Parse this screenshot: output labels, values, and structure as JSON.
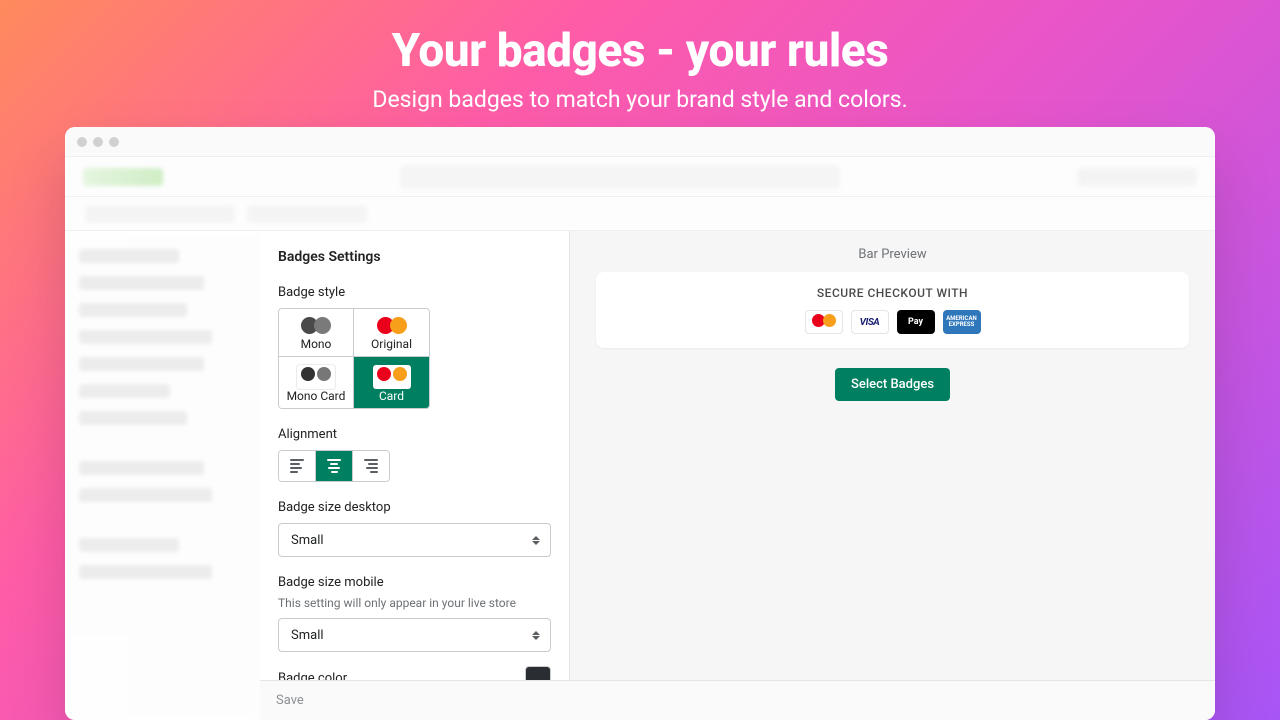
{
  "hero": {
    "title": "Your badges - your rules",
    "subtitle": "Design badges to match your brand style and colors."
  },
  "settings": {
    "heading": "Badges Settings",
    "style_label": "Badge style",
    "styles": {
      "mono": "Mono",
      "original": "Original",
      "mono_card": "Mono Card",
      "card": "Card"
    },
    "alignment_label": "Alignment",
    "size_desktop_label": "Badge size desktop",
    "size_desktop_value": "Small",
    "size_mobile_label": "Badge size mobile",
    "size_mobile_help": "This setting will only appear in your live store",
    "size_mobile_value": "Small",
    "badge_color_label": "Badge color",
    "badge_color_value": "#2a2e33"
  },
  "preview": {
    "label": "Bar Preview",
    "secure_text": "SECURE CHECKOUT WITH",
    "select_badges_btn": "Select Badges",
    "visa": "VISA",
    "apple_pay": "Pay",
    "amex": "AMERICAN EXPRESS"
  },
  "footer": {
    "save": "Save"
  }
}
